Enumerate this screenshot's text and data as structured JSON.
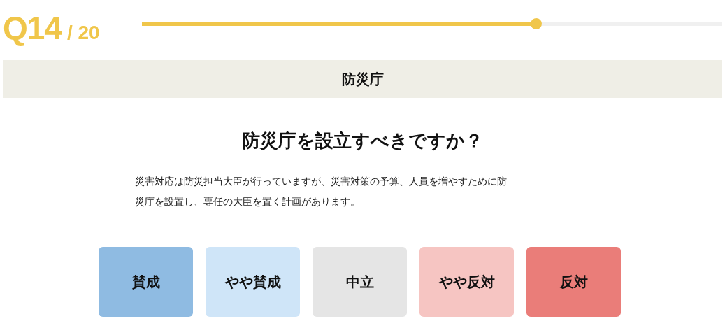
{
  "header": {
    "number": "Q14",
    "total": "/ 20",
    "level": 0.68
  },
  "category": "防災庁",
  "question": "防災庁を設立すべきですか？",
  "description": [
    "災害対応は防災担当大臣が行っていますが、災害対策の予算、人員を増やすために防",
    "災庁を設置し、専任の大臣を置く計画があります。"
  ],
  "answers": [
    {
      "label": "賛成",
      "color": "#8fbbe2"
    },
    {
      "label": "やや賛成",
      "color": "#cfe5f8"
    },
    {
      "label": "中立",
      "color": "#e5e5e5"
    },
    {
      "label": "やや反対",
      "color": "#f6c5c2"
    },
    {
      "label": "反対",
      "color": "#ea7d79"
    }
  ]
}
